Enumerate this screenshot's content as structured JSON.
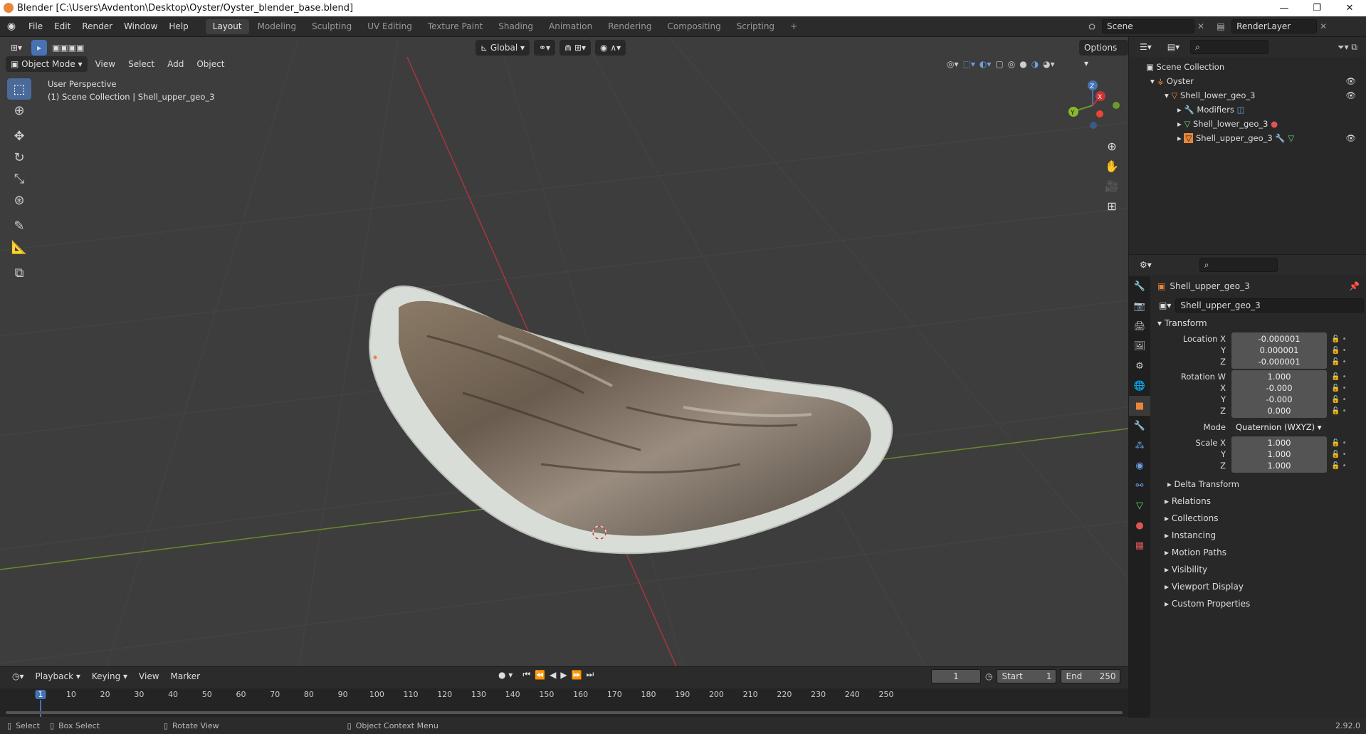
{
  "window": {
    "title": "Blender [C:\\Users\\Avdenton\\Desktop\\Oyster/Oyster_blender_base.blend]",
    "min": "—",
    "max": "❐",
    "close": "✕"
  },
  "menubar": {
    "items": [
      "File",
      "Edit",
      "Render",
      "Window",
      "Help"
    ]
  },
  "workspaces": {
    "tabs": [
      "Layout",
      "Modeling",
      "Sculpting",
      "UV Editing",
      "Texture Paint",
      "Shading",
      "Animation",
      "Rendering",
      "Compositing",
      "Scripting"
    ],
    "add": "+"
  },
  "scene": {
    "name": "Scene",
    "view_layer": "RenderLayer"
  },
  "viewport": {
    "mode": "Object Mode",
    "menus": [
      "View",
      "Select",
      "Add",
      "Object"
    ],
    "orientation": "Global",
    "options": "Options",
    "info_line1": "User Perspective",
    "info_line2": "(1) Scene Collection | Shell_upper_geo_3",
    "gizmo": {
      "z": "Z",
      "y": "Y",
      "x": "X"
    }
  },
  "timeline": {
    "menus": [
      "Playback",
      "Keying",
      "View",
      "Marker"
    ],
    "current_frame": "1",
    "start_label": "Start",
    "start": "1",
    "end_label": "End",
    "end": "250",
    "ticks": [
      "1",
      "10",
      "20",
      "30",
      "40",
      "50",
      "60",
      "70",
      "80",
      "90",
      "100",
      "110",
      "120",
      "130",
      "140",
      "150",
      "160",
      "170",
      "180",
      "190",
      "200",
      "210",
      "220",
      "230",
      "240",
      "250"
    ]
  },
  "outliner": {
    "root": "Scene Collection",
    "items": [
      {
        "label": "Oyster"
      },
      {
        "label": "Shell_lower_geo_3"
      },
      {
        "label": "Modifiers"
      },
      {
        "label": "Shell_lower_geo_3"
      },
      {
        "label": "Shell_upper_geo_3"
      }
    ]
  },
  "properties": {
    "object_name": "Shell_upper_geo_3",
    "object_field": "Shell_upper_geo_3",
    "transform_title": "Transform",
    "location": {
      "x_label": "Location X",
      "y_label": "Y",
      "z_label": "Z",
      "x": "-0.000001",
      "y": "0.000001",
      "z": "-0.000001"
    },
    "rotation": {
      "w_label": "Rotation W",
      "x_label": "X",
      "y_label": "Y",
      "z_label": "Z",
      "w": "1.000",
      "x": "-0.000",
      "y": "-0.000",
      "z": "0.000"
    },
    "mode_label": "Mode",
    "mode": "Quaternion (WXYZ)",
    "scale": {
      "x_label": "Scale X",
      "y_label": "Y",
      "z_label": "Z",
      "x": "1.000",
      "y": "1.000",
      "z": "1.000"
    },
    "delta": "Delta Transform",
    "panels": [
      "Relations",
      "Collections",
      "Instancing",
      "Motion Paths",
      "Visibility",
      "Viewport Display",
      "Custom Properties"
    ]
  },
  "status": {
    "select": "Select",
    "box_select": "Box Select",
    "rotate": "Rotate View",
    "context": "Object Context Menu",
    "version": "2.92.0"
  },
  "colors": {
    "accent": "#4772b3",
    "viewport_bg": "#3d3d3d",
    "x_axis": "#a8363c",
    "y_axis": "#6a8a2a",
    "object_orange": "#e8863a"
  }
}
